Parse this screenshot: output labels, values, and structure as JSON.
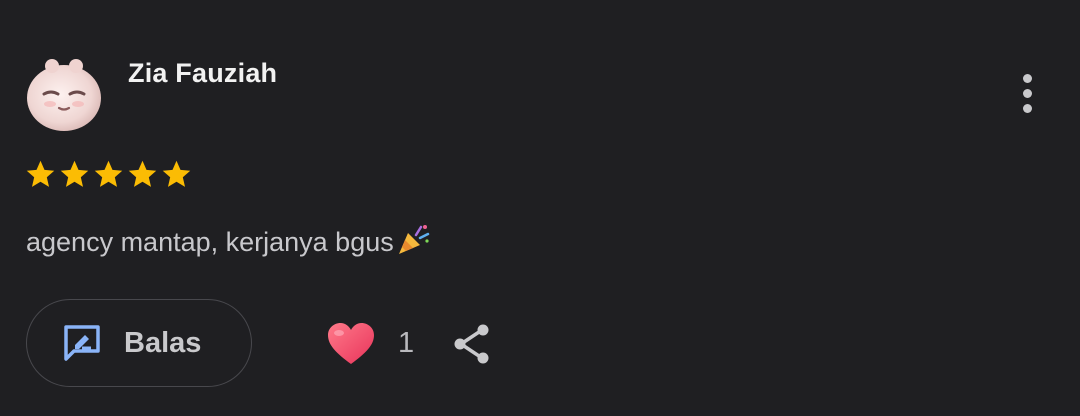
{
  "review": {
    "author": "Zia Fauziah",
    "rating": 5,
    "rating_max": 5,
    "text": "agency mantap, kerjanya bgus",
    "text_emoji": "party-popper-icon"
  },
  "actions": {
    "reply_label": "Balas",
    "like_count": "1"
  },
  "colors": {
    "background": "#1f1f22",
    "star": "#fbbc04",
    "reply_icon": "#8ab4f8",
    "heart": "#f0476a"
  }
}
